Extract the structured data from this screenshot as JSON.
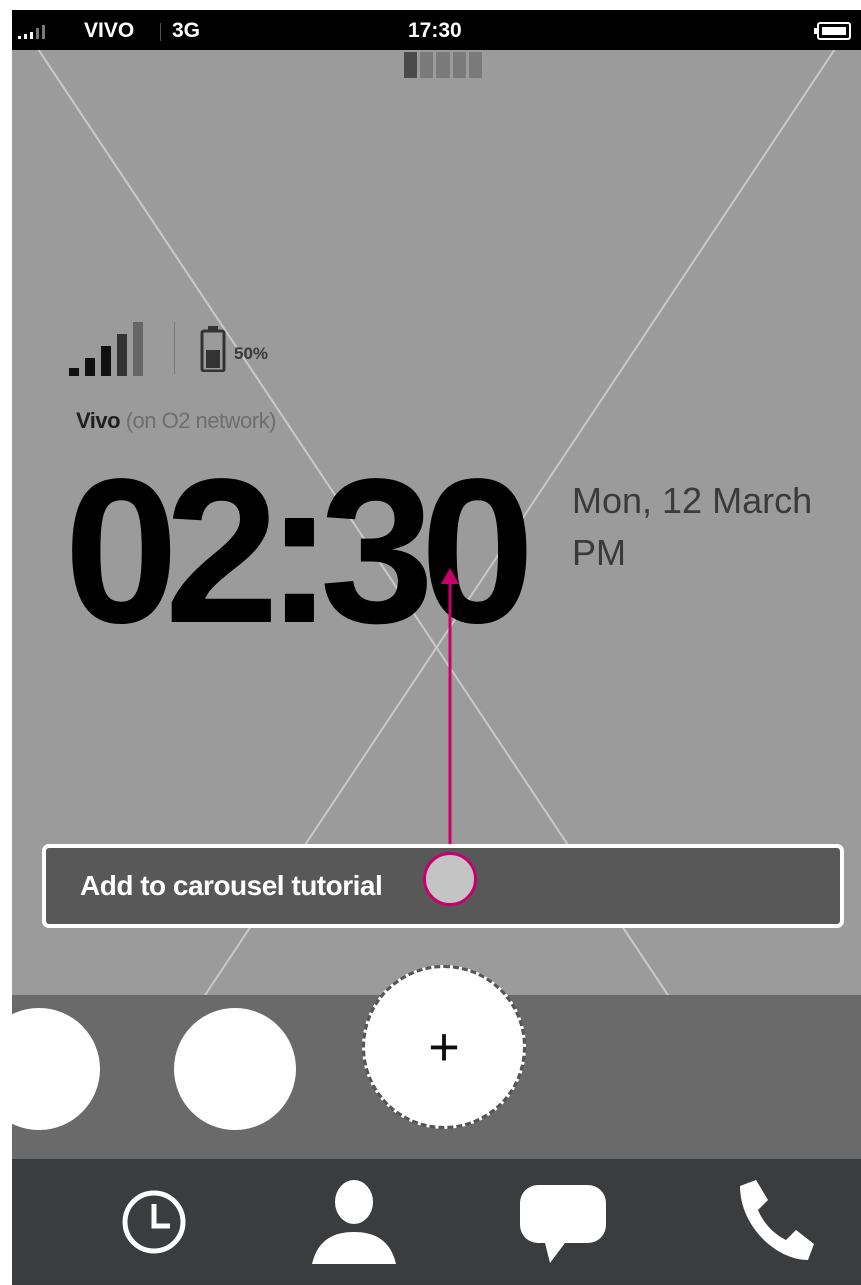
{
  "status_bar": {
    "carrier": "VIVO",
    "network": "3G",
    "time": "17:30"
  },
  "lock_screen": {
    "battery_percent": "50%",
    "carrier_name": "Vivo",
    "carrier_network": "(on O2 network)",
    "time": "02:30",
    "date": "Mon, 12 March",
    "ampm": "PM"
  },
  "tutorial": {
    "label": "Add to carousel tutorial"
  },
  "carousel": {
    "add_symbol": "+"
  },
  "nav": {
    "icons": [
      "clock-icon",
      "person-icon",
      "chat-bubble-icon",
      "phone-handset-icon"
    ]
  },
  "colors": {
    "background": "#9b9b9b",
    "status_bar": "#000000",
    "carousel": "#6a6a6a",
    "nav_bar": "#3b3c3d",
    "annotation_accent": "#c8006e"
  }
}
